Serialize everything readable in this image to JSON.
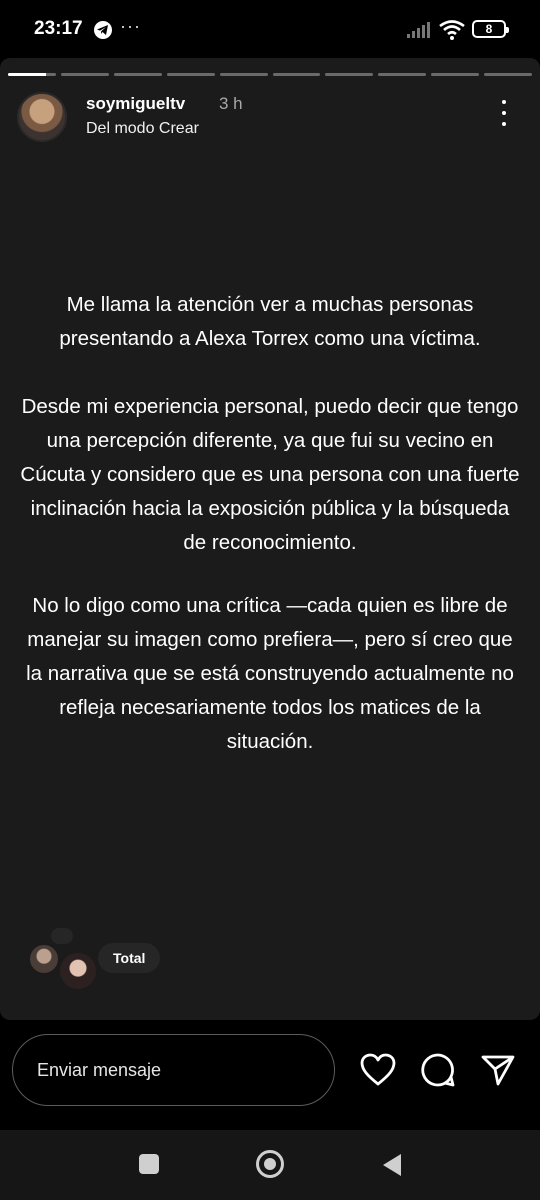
{
  "status_bar": {
    "time": "23:17",
    "notification_icons": [
      "telegram-icon",
      "more-dots-icon"
    ],
    "more": "···",
    "battery": "8"
  },
  "story": {
    "progress": {
      "segments": 10,
      "current_segment_fill": 0.8
    },
    "username": "soymigueltv",
    "time_ago": "3 h",
    "mode": "Del modo Crear",
    "paragraphs": [
      "Me llama la atención ver a muchas personas presentando a Alexa Torrex como una víctima.",
      "Desde mi experiencia personal, puedo decir que tengo una percepción diferente, ya que fui su vecino en Cúcuta y considero que es una persona con una fuerte inclinación hacia la exposición pública y la búsqueda de reconocimiento.",
      "No lo digo como una crítica —cada quien es libre de manejar su imagen como prefiera—, pero sí creo que la narrativa que se está construyendo actualmente no refleja necesariamente todos los matices de la situación."
    ],
    "viewers_label": "Total"
  },
  "reply_bar": {
    "message_placeholder": "Enviar mensaje",
    "actions": [
      "heart-icon",
      "comment-icon",
      "send-icon"
    ]
  },
  "nav_bar": {
    "buttons": [
      "recents",
      "home",
      "back"
    ]
  },
  "colors": {
    "story_background": "#1b1b1b",
    "screen_background": "#000000",
    "secondary_text": "#a8a8a8"
  }
}
